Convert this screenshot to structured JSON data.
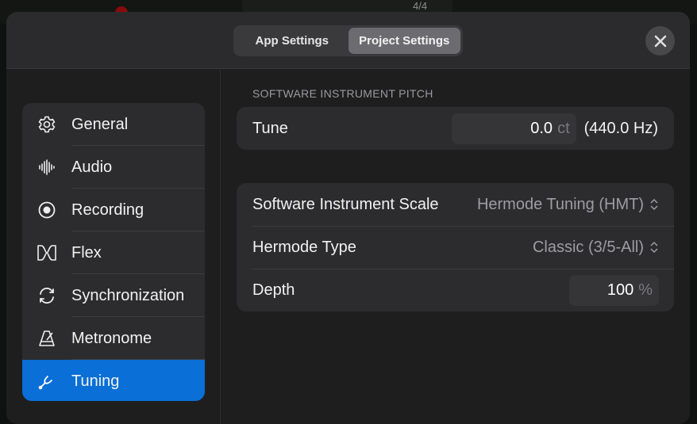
{
  "background": {
    "time_signature": "4/4"
  },
  "header": {
    "tabs": [
      {
        "label": "App Settings",
        "active": false
      },
      {
        "label": "Project Settings",
        "active": true
      }
    ],
    "close_icon": "xmark-icon"
  },
  "sidebar": {
    "items": [
      {
        "label": "General",
        "icon": "gear-icon"
      },
      {
        "label": "Audio",
        "icon": "waveform-icon"
      },
      {
        "label": "Recording",
        "icon": "record-circle-icon"
      },
      {
        "label": "Flex",
        "icon": "flex-icon"
      },
      {
        "label": "Synchronization",
        "icon": "sync-arrows-icon"
      },
      {
        "label": "Metronome",
        "icon": "metronome-icon"
      },
      {
        "label": "Tuning",
        "icon": "tuning-fork-icon",
        "selected": true
      }
    ]
  },
  "main": {
    "section_title": "SOFTWARE INSTRUMENT PITCH",
    "tune": {
      "label": "Tune",
      "value": "0.0",
      "unit": "ct",
      "hz": "(440.0 Hz)"
    },
    "scale": {
      "label": "Software Instrument Scale",
      "value": "Hermode Tuning (HMT)"
    },
    "hermode_type": {
      "label": "Hermode Type",
      "value": "Classic (3/5-All)"
    },
    "depth": {
      "label": "Depth",
      "value": "100",
      "unit": "%"
    }
  },
  "colors": {
    "accent": "#0a6fd6",
    "panel": "#2c2c2e",
    "background": "#1e1e1f"
  }
}
